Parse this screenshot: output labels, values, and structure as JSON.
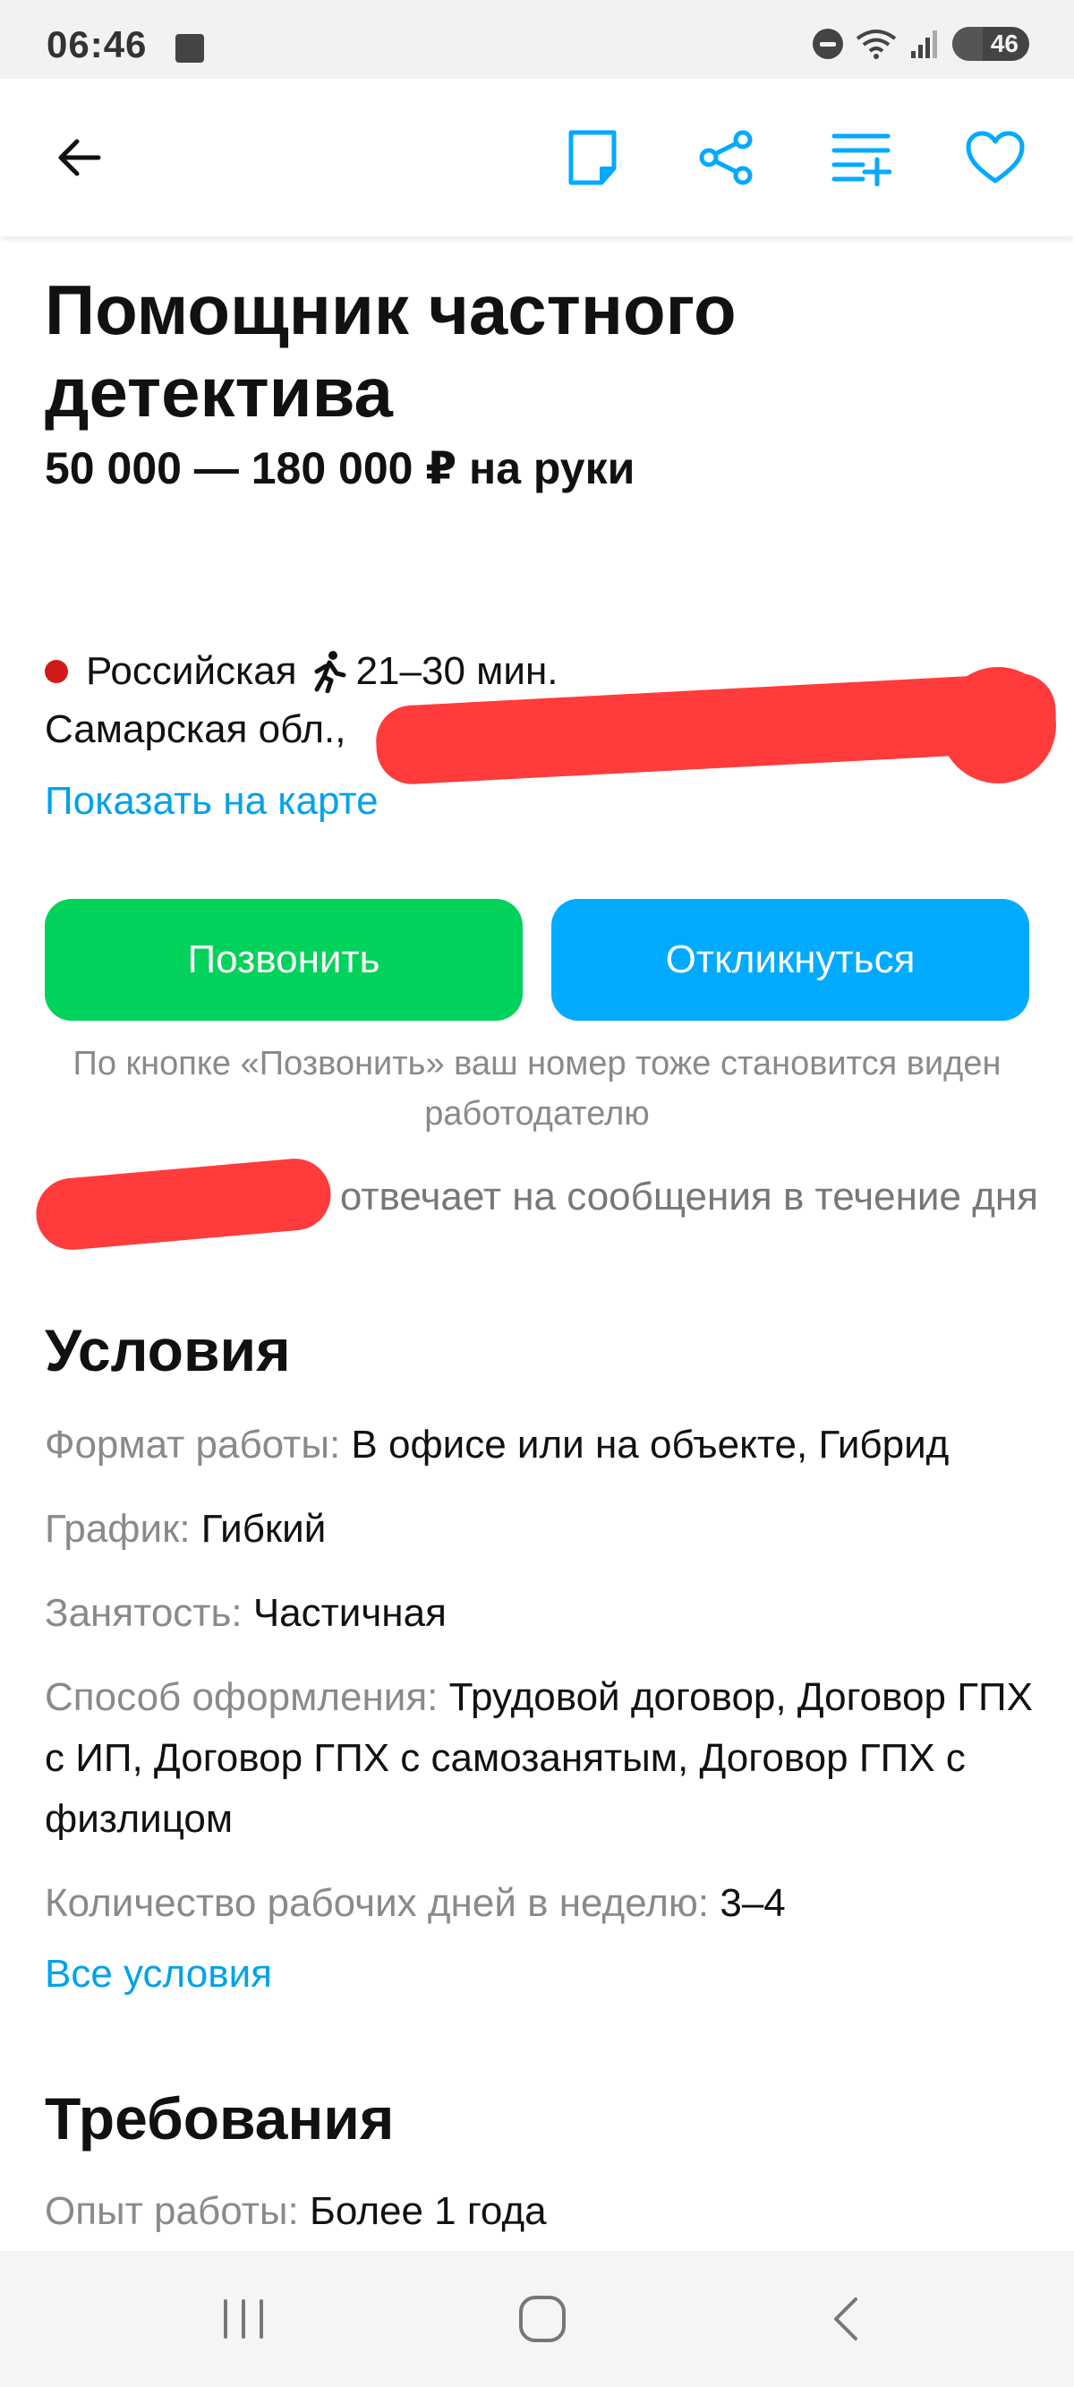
{
  "status_bar": {
    "time": "06:46",
    "battery": "46"
  },
  "header": {
    "icons": [
      "arrow-left-icon",
      "note-icon",
      "share-icon",
      "compare-list-icon",
      "heart-icon"
    ],
    "accent_color": "#00aaff"
  },
  "vacancy": {
    "title": "Помощник частного детектива",
    "salary": "50 000 — 180 000 ₽ на руки",
    "metro_station": "Российская",
    "walk_time": "21–30 мин.",
    "address": "Самарская обл., ",
    "map_link": "Показать на карте"
  },
  "actions": {
    "call_label": "Позвонить",
    "reply_label": "Откликнуться",
    "call_note": "По кнопке «Позвонить» ваш номер тоже становится виден работодателю",
    "response_note": "отвечает на сообщения в течение дня"
  },
  "conditions": {
    "title": "Условия",
    "rows": [
      {
        "label": "Формат работы:",
        "value": "В офисе или на объекте, Гибрид"
      },
      {
        "label": "График:",
        "value": "Гибкий"
      },
      {
        "label": "Занятость:",
        "value": "Частичная"
      },
      {
        "label": "Способ оформления:",
        "value": "Трудовой договор, Договор ГПХ с ИП, Договор ГПХ с самозанятым, Договор ГПХ с физлицом"
      },
      {
        "label": "Количество рабочих дней в неделю:",
        "value": "3–4"
      }
    ],
    "all_link": "Все условия"
  },
  "requirements": {
    "title": "Требования",
    "rows": [
      {
        "label": "Опыт работы:",
        "value": "Более 1 года"
      }
    ]
  },
  "colors": {
    "call_button": "#00d25b",
    "reply_button": "#00aaff",
    "link": "#00a2e8",
    "metro_dot": "#d01a1a"
  }
}
